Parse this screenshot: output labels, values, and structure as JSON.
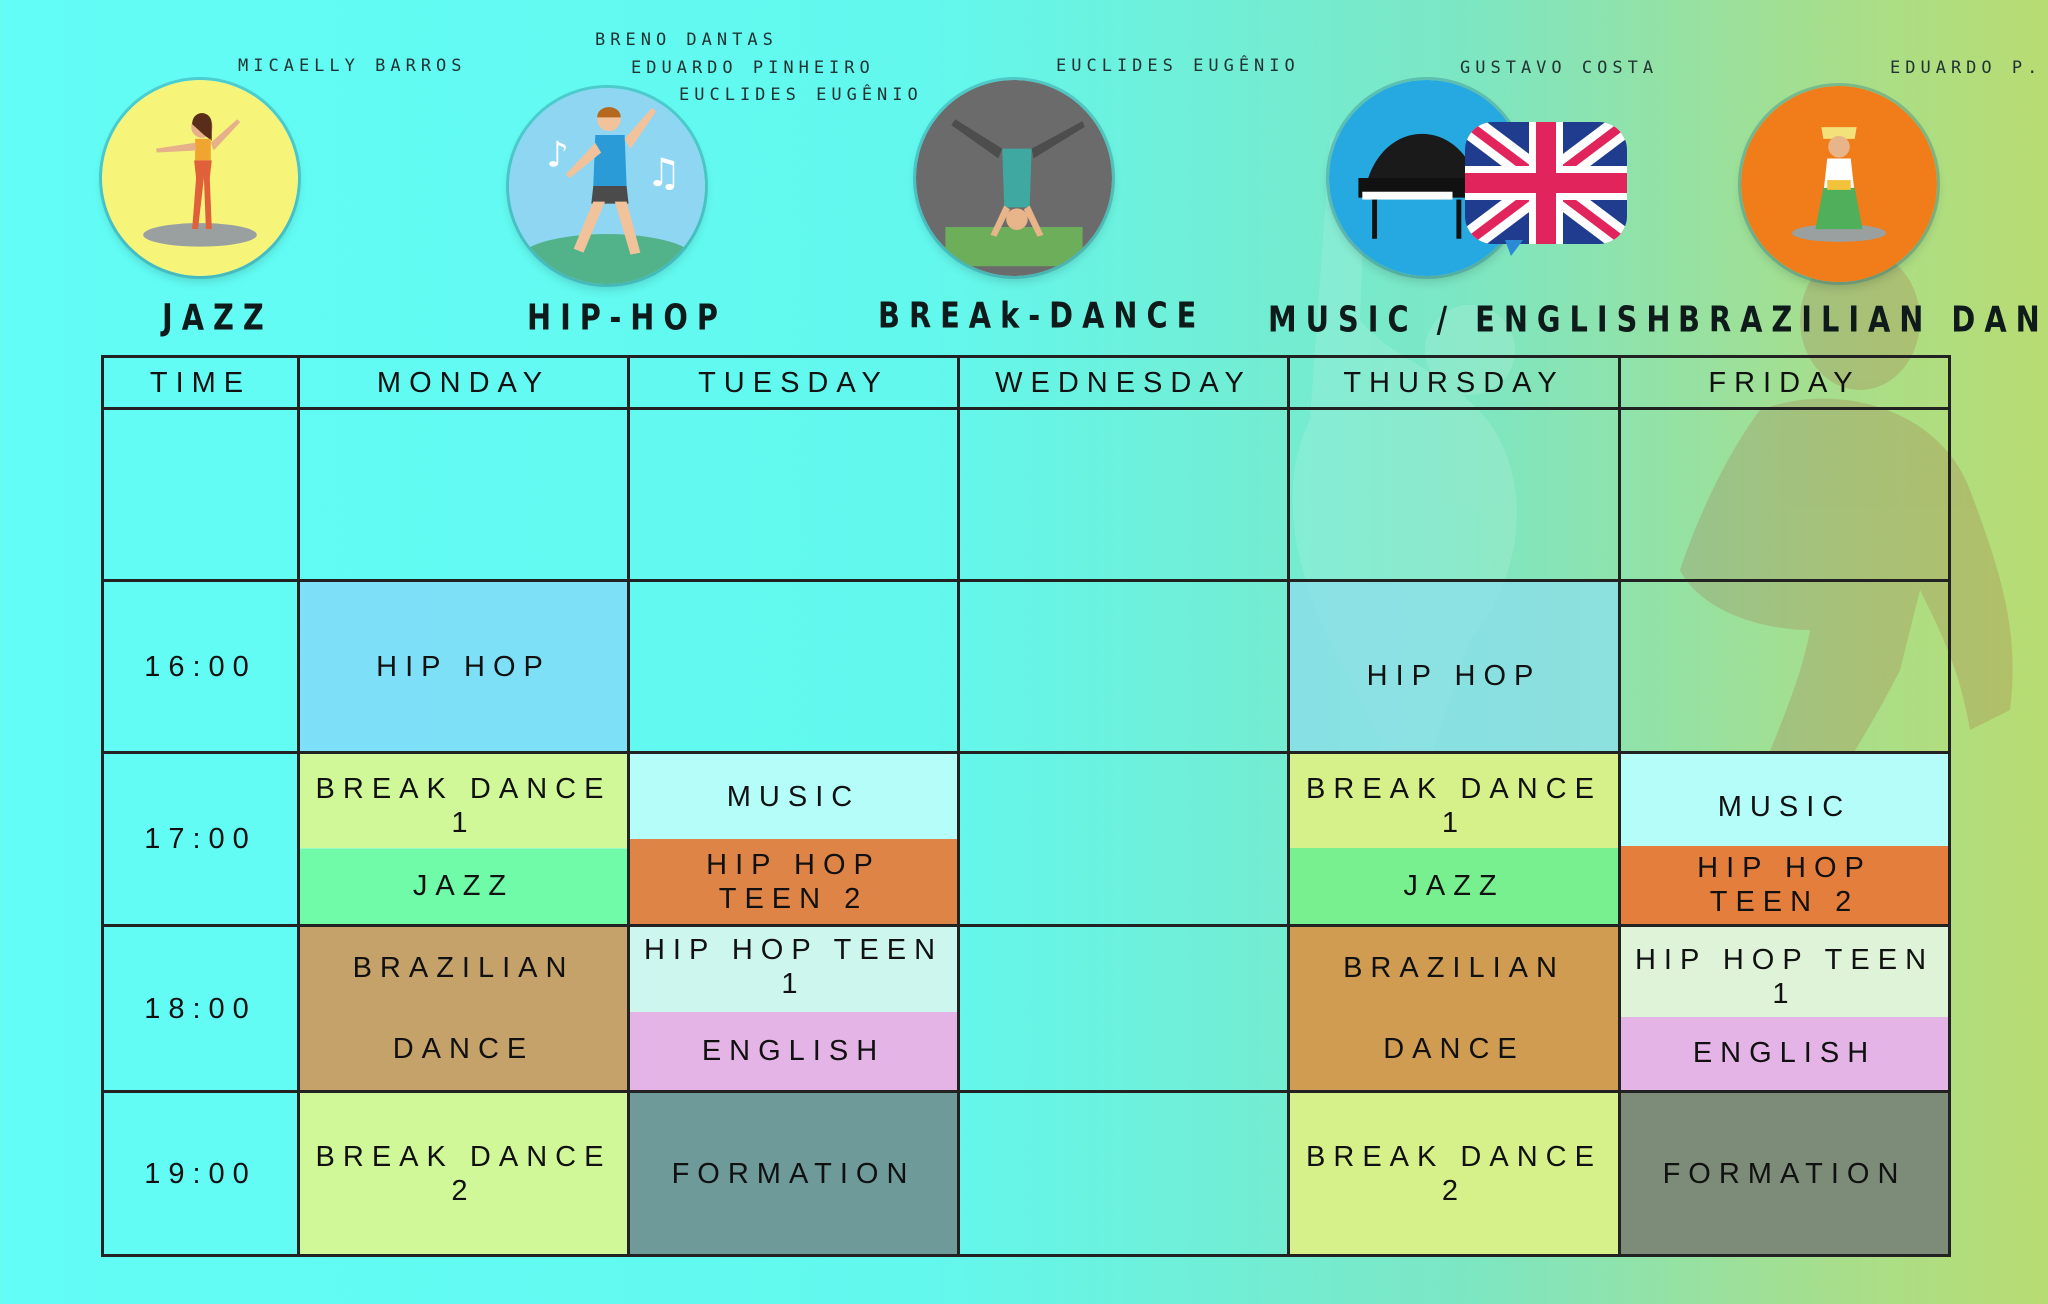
{
  "styles": [
    {
      "title": "JAZZ",
      "teachers": [
        "MICAELLY BARROS"
      ],
      "circle_color": "#f6f57a"
    },
    {
      "title": "HIP-HOP",
      "teachers": [
        "BRENO DANTAS",
        "EDUARDO PINHEIRO",
        "EUCLIDES EUGÊNIO"
      ],
      "circle_color": "#8fd6f3"
    },
    {
      "title": "BREAk-DANCE",
      "teachers": [
        "EUCLIDES EUGÊNIO"
      ],
      "circle_color": "#6b6b6b"
    },
    {
      "title": "MUSIC / ENGLISH",
      "teachers": [
        "GUSTAVO COSTA"
      ],
      "circle_color": "#26a9e0"
    },
    {
      "title": "BRAZILIAN DANCE",
      "teachers": [
        "EDUARDO P."
      ],
      "circle_color": "#f07d1a"
    }
  ],
  "table": {
    "headers": [
      "TIME",
      "MONDAY",
      "TUESDAY",
      "WEDNESDAY",
      "THURSDAY",
      "FRIDAY"
    ],
    "times": [
      "",
      "16:00",
      "17:00",
      "18:00",
      "19:00"
    ],
    "rows": [
      {
        "mon": "",
        "tue": "",
        "wed": "",
        "thu": "",
        "fri": ""
      },
      {
        "mon": "HIP HOP",
        "thu": "HIP HOP"
      },
      {
        "mon_top": "BREAK DANCE 1",
        "mon_bottom": "JAZZ",
        "tue_top": "MUSIC",
        "tue_bottom": "HIP HOP TEEN 2",
        "thu_top": "BREAK DANCE 1",
        "thu_bottom": "JAZZ",
        "fri_top": "MUSIC",
        "fri_bottom": "HIP HOP TEEN 2"
      },
      {
        "mon_top": "BRAZILIAN",
        "mon_bottom": "DANCE",
        "tue_top": "HIP HOP TEEN 1",
        "tue_bottom": "ENGLISH",
        "thu_top": "BRAZILIAN",
        "thu_bottom": "DANCE",
        "fri_top": "HIP HOP TEEN 1",
        "fri_bottom": "ENGLISH"
      },
      {
        "mon": "BREAK DANCE 2",
        "tue": "FORMATION",
        "thu": "BREAK DANCE 2",
        "fri": "FORMATION"
      }
    ]
  },
  "colors": {
    "hiphop": "#77e3f6",
    "hiphop_thu": "#86dfe4",
    "breakdance": "#d1f898",
    "jazz": "#70fba8",
    "jazz_thu": "#78f08f",
    "music": "#b4fdf8",
    "teen2": "#df8447",
    "brazilian": "#c5a26a",
    "brazilian_thu": "#cf9c52",
    "teen1": "#cdf6ee",
    "teen1_fri": "#def3d8",
    "english": "#e4b4e6",
    "formation": "#6e9a9a",
    "formation_fri": "#7d8c78"
  }
}
